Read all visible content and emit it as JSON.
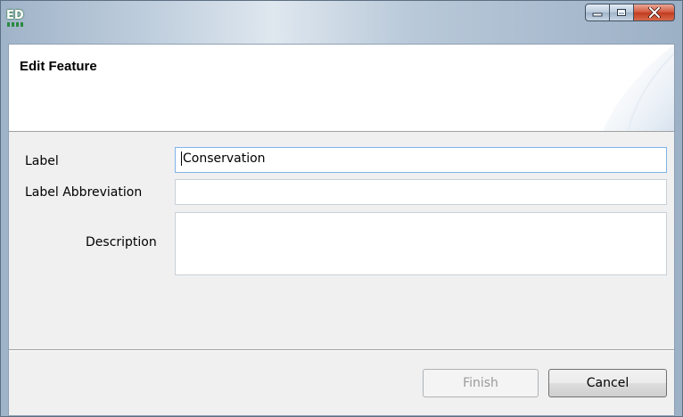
{
  "window": {
    "app_icon_text": "ED",
    "app_icon": "ed-app-icon",
    "controls": {
      "minimize_icon": "minimize-icon",
      "maximize_icon": "maximize-icon",
      "close_icon": "close-icon"
    }
  },
  "header": {
    "title": "Edit Feature"
  },
  "form": {
    "label_field": {
      "label": "Label",
      "value": "Conservation"
    },
    "abbreviation_field": {
      "label": "Label Abbreviation",
      "value": ""
    },
    "description_field": {
      "label": "Description",
      "value": ""
    }
  },
  "buttons": {
    "finish": "Finish",
    "cancel": "Cancel"
  },
  "colors": {
    "close_button": "#c23a20",
    "focused_border": "#7eb4ea",
    "disabled_text": "#9a9a9a"
  }
}
